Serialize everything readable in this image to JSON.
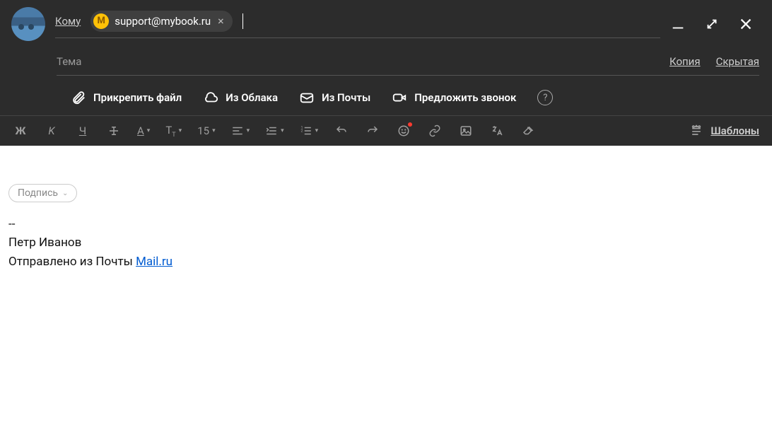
{
  "recipient": {
    "to_label": "Кому",
    "chip_letter": "М",
    "chip_email": "support@mybook.ru",
    "chip_close": "×"
  },
  "subject": {
    "placeholder": "Тема",
    "value": "",
    "cc_label": "Копия",
    "bcc_label": "Скрытая"
  },
  "attach": {
    "file": "Прикрепить файл",
    "cloud": "Из Облака",
    "mail": "Из Почты",
    "call": "Предложить звонок"
  },
  "formatting": {
    "bold_glyph": "Ж",
    "italic_glyph": "K",
    "font_size": "15",
    "templates": "Шаблоны"
  },
  "body": {
    "signature_btn": "Подпись",
    "sep": "--",
    "name": "Петр Иванов",
    "sent_prefix": "Отправлено из Почты ",
    "sent_link": "Mail.ru"
  }
}
